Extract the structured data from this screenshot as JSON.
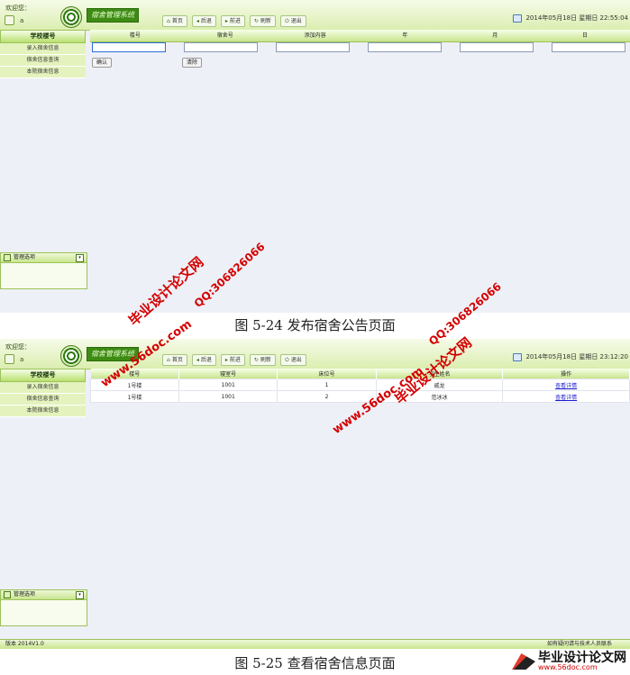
{
  "shared": {
    "welcome": "欢迎您：",
    "username": "a",
    "logo_title": "宿舍管理系统",
    "toolbar": [
      "首页",
      "后退",
      "前进",
      "刷新",
      "退出"
    ],
    "sidebar_title": "学校楼号",
    "sidebar_items": [
      "录入宿舍信息",
      "宿舍信息查询",
      "本院宿舍信息"
    ],
    "manage_title": "管理选项"
  },
  "screen1": {
    "datetime": "2014年05月18日 星期日 22:55:04",
    "form_headers": [
      "楼号",
      "宿舍号",
      "添加内容",
      "年",
      "月",
      "日"
    ],
    "confirm_label": "确认",
    "clear_label": "清除"
  },
  "screen2": {
    "datetime": "2014年05月18日 星期日 23:12:20",
    "table_headers": [
      "楼号",
      "寝室号",
      "床位号",
      "学生姓名",
      "操作"
    ],
    "rows": [
      [
        "1号楼",
        "1001",
        "1",
        "戚龙",
        "查看详情"
      ],
      [
        "1号楼",
        "1001",
        "2",
        "范冰冰",
        "查看详情"
      ]
    ],
    "footer_version": "版本 2014V1.0",
    "footer_right": "如有疑问请与技术人员联系"
  },
  "captions": {
    "fig1": "图 5-24 发布宿舍公告页面",
    "fig2": "图 5-25 查看宿舍信息页面"
  },
  "watermarks": {
    "site_cn": "毕业设计论文网",
    "url": "www.56doc.com",
    "qq": "QQ:306826066",
    "corner_cn": "毕业设计论文网",
    "corner_url": "www.56doc.com"
  },
  "colors": {
    "accent_green": "#9bc25a",
    "link_blue": "#1a1ad0",
    "watermark_red": "#d40000"
  }
}
